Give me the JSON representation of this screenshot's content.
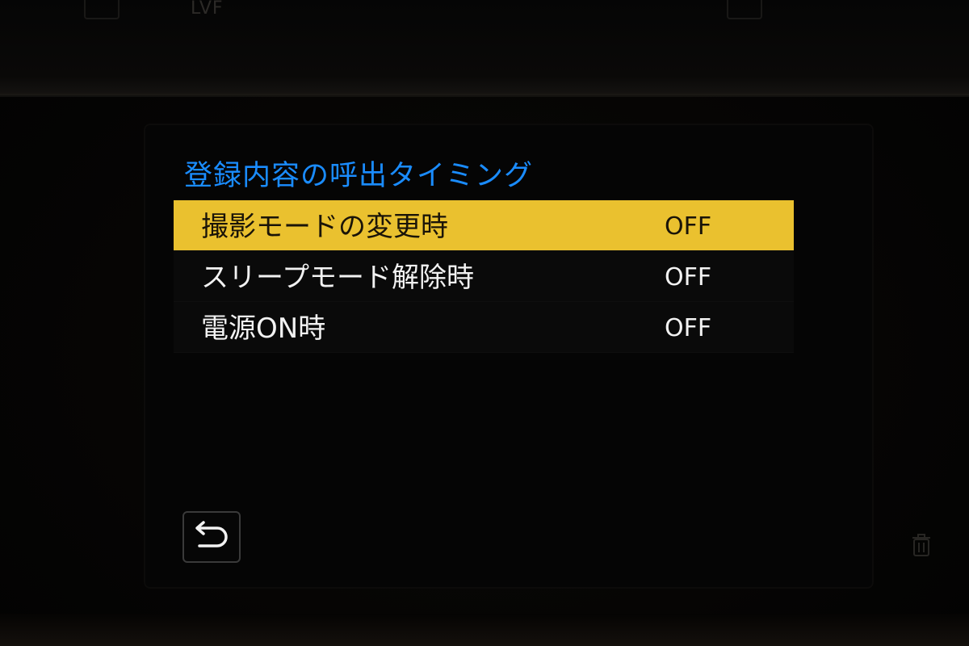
{
  "top": {
    "lvf_label": "LVF"
  },
  "menu": {
    "title": "登録内容の呼出タイミング",
    "items": [
      {
        "label": "撮影モードの変更時",
        "value": "OFF",
        "selected": true
      },
      {
        "label": "スリープモード解除時",
        "value": "OFF",
        "selected": false
      },
      {
        "label": "電源ON時",
        "value": "OFF",
        "selected": false
      }
    ]
  },
  "icons": {
    "back": "return-arrow-icon",
    "delete": "trash-icon",
    "playback": "playback-icon",
    "display": "display-icon"
  },
  "colors": {
    "title": "#1a8cff",
    "highlight": "#eac12f",
    "text": "#f2f2f2",
    "background": "#000000"
  }
}
